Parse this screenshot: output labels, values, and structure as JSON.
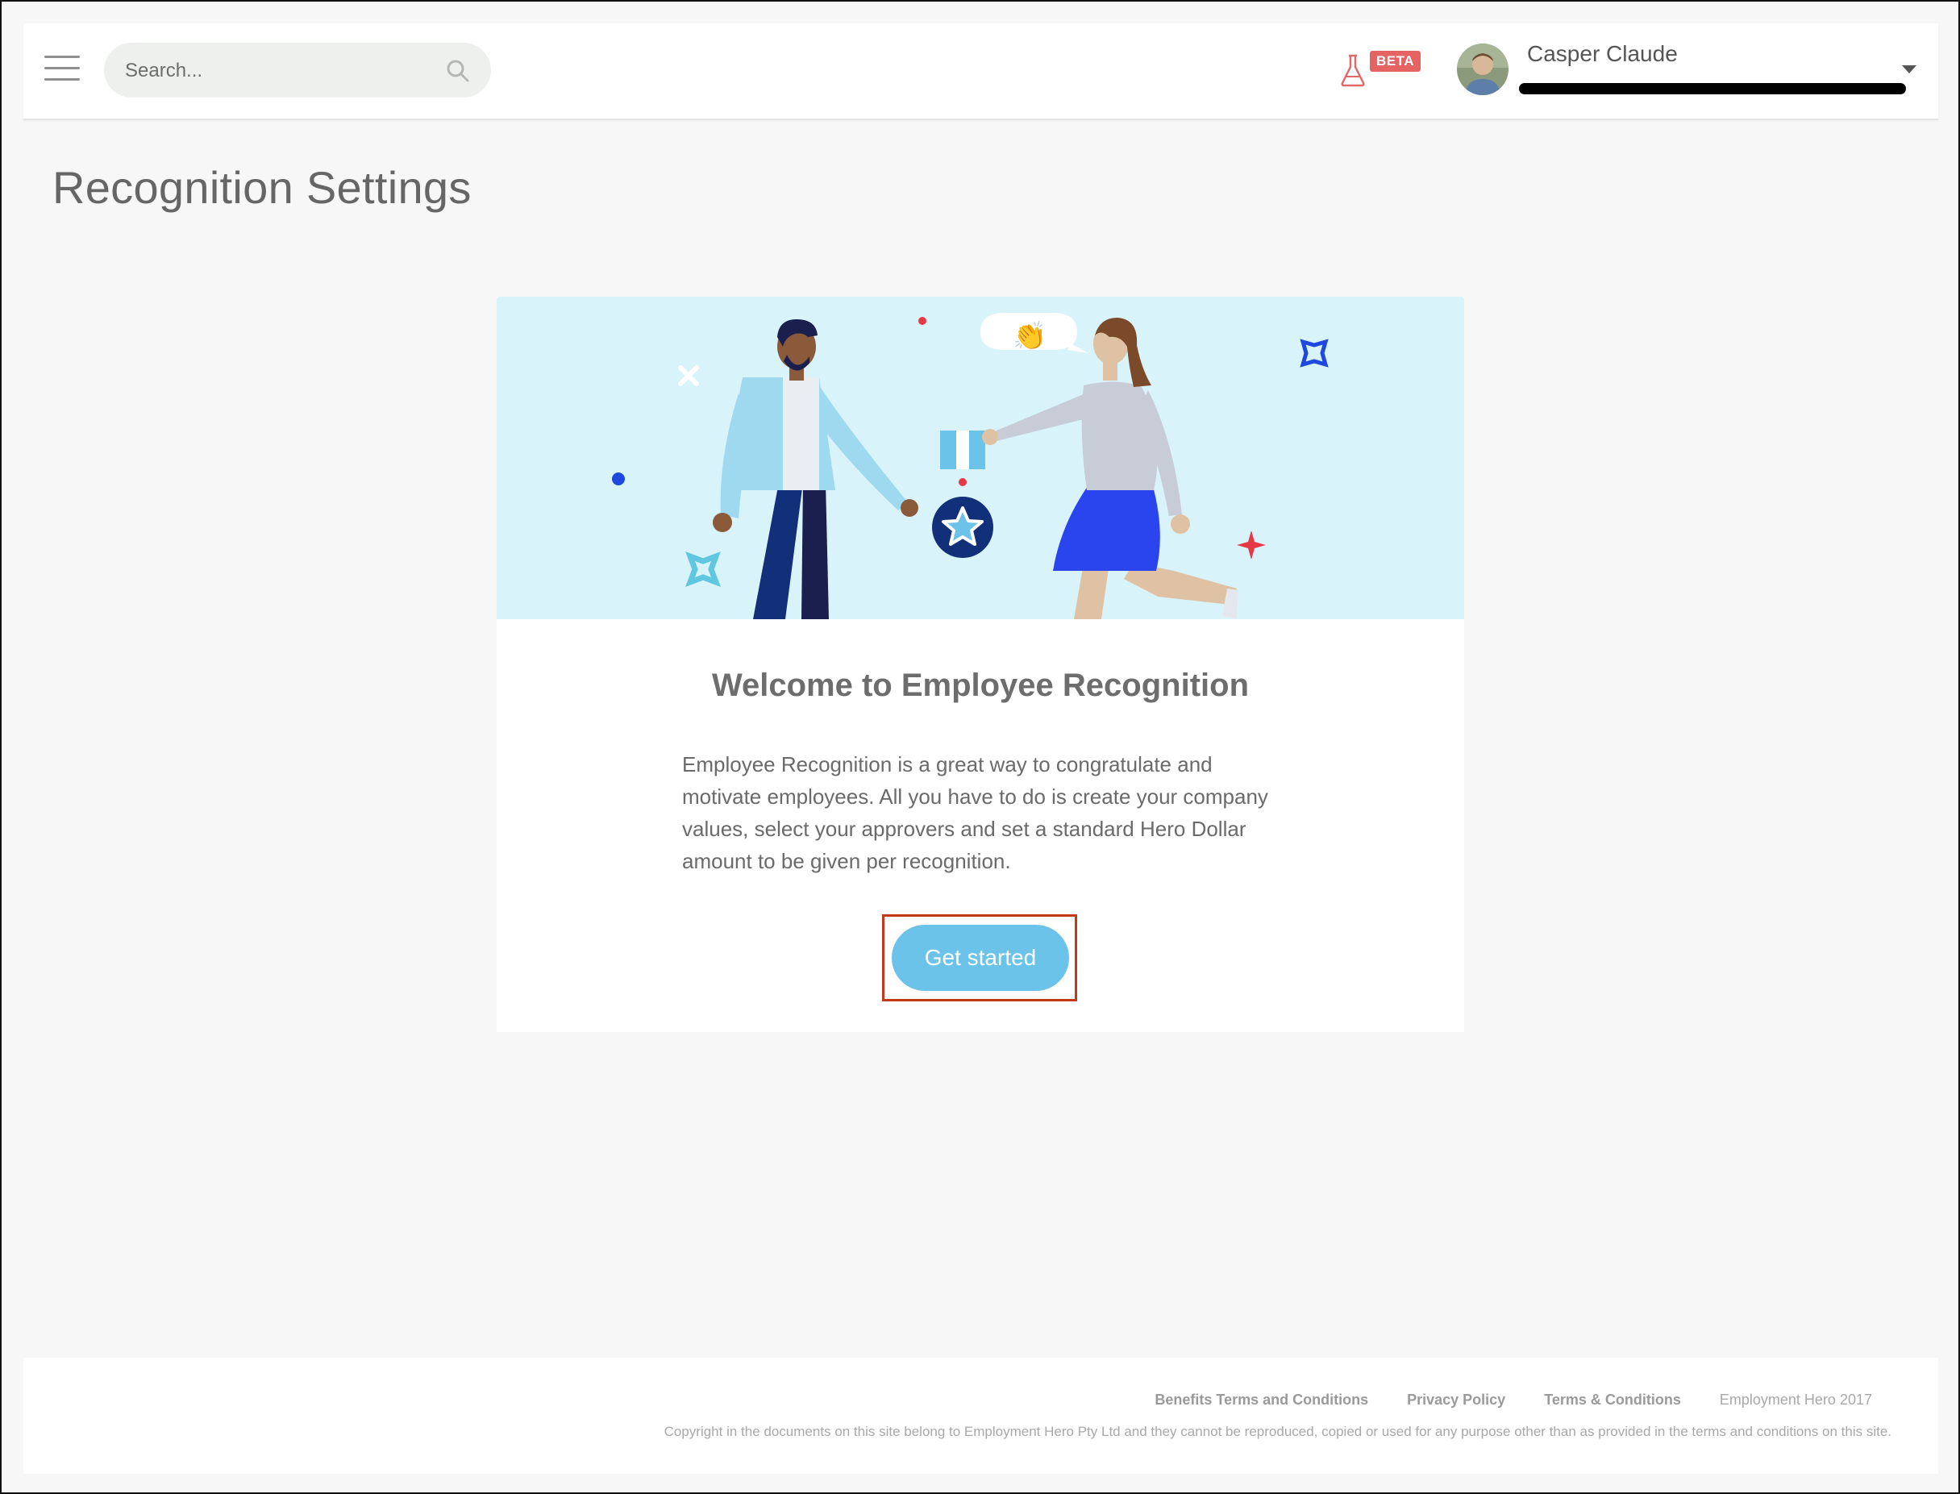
{
  "header": {
    "search": {
      "placeholder": "Search..."
    },
    "beta_label": "BETA",
    "user": {
      "name": "Casper Claude"
    }
  },
  "page": {
    "title": "Recognition Settings"
  },
  "card": {
    "title": "Welcome to Employee Recognition",
    "description": "Employee Recognition is a great way to congratulate and motivate employees. All you have to do is create your company values, select your approvers and set a standard Hero Dollar amount to be given per recognition.",
    "cta_label": "Get started"
  },
  "footer": {
    "links": [
      "Benefits Terms and Conditions",
      "Privacy Policy",
      "Terms & Conditions"
    ],
    "brand": "Employment Hero 2017",
    "copyright": "Copyright in the documents on this site belong to Employment Hero Pty Ltd and they cannot be reproduced, copied or used for any purpose other than as provided in the terms and conditions on this site."
  },
  "colors": {
    "accent": "#6cc3ea",
    "highlight_border": "#c0391b",
    "beta_badge": "#e56363",
    "hero_bg": "#d9f3fa"
  }
}
